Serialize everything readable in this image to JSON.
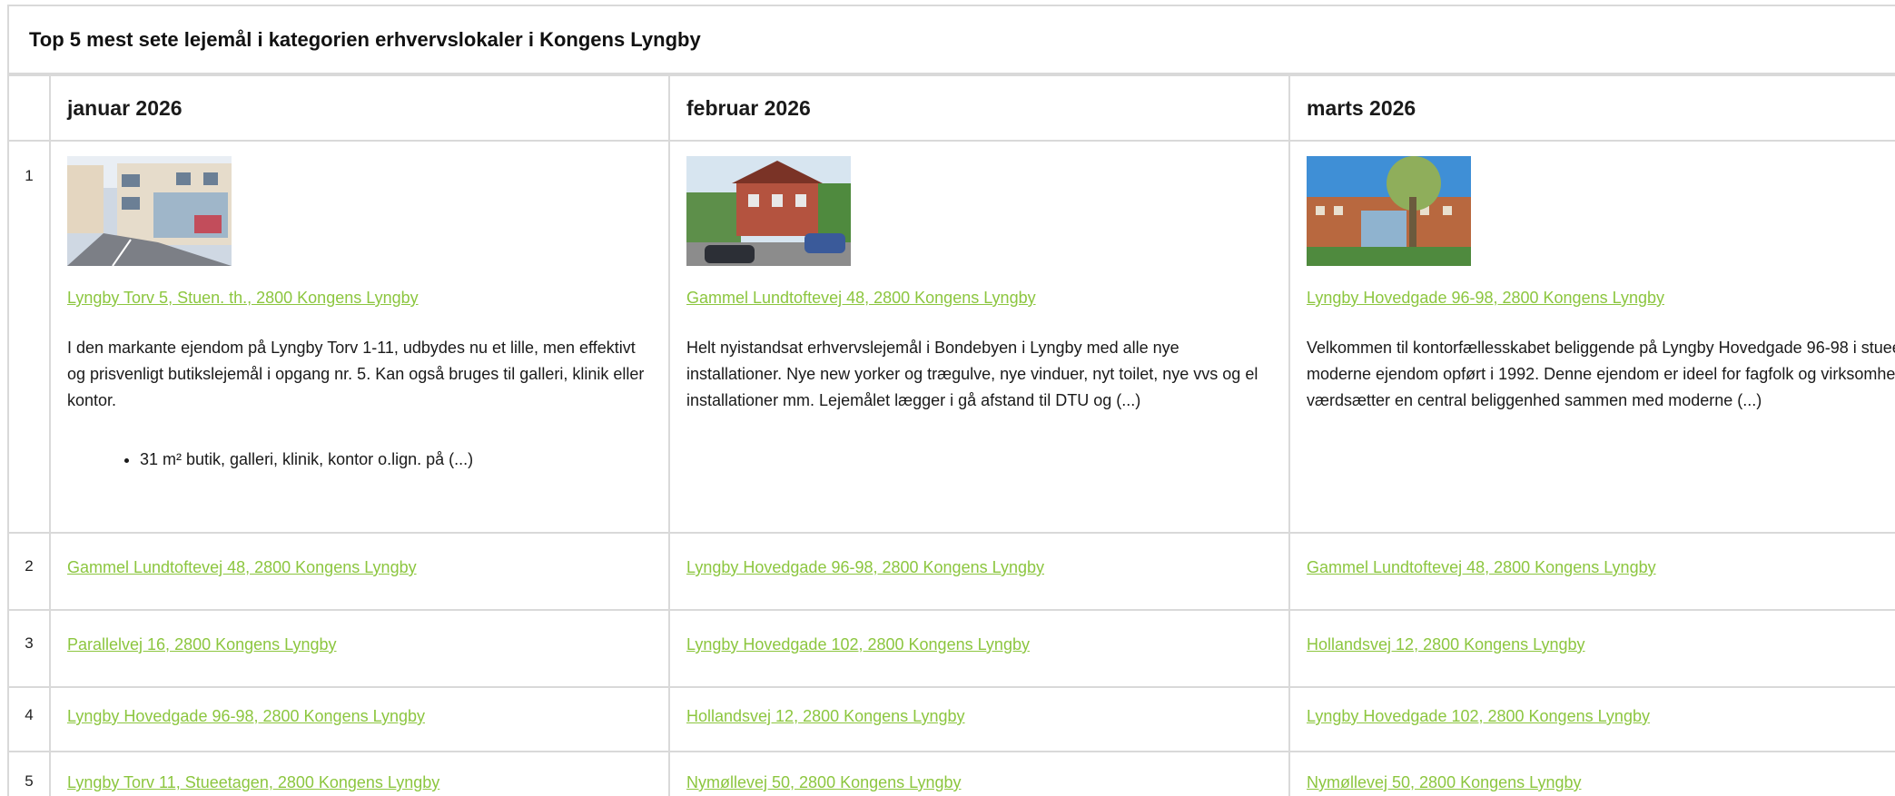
{
  "title": "Top 5 mest sete lejemål i kategorien erhvervslokaler i Kongens Lyngby",
  "colors": {
    "link": "#8cc63f",
    "border": "#d9d9d9"
  },
  "months": [
    "januar 2026",
    "februar 2026",
    "marts 2026"
  ],
  "top": {
    "rank": "1",
    "entries": [
      {
        "image": "street-storefront-photo",
        "address": "Lyngby Torv 5, Stuen. th., 2800 Kongens Lyngby",
        "description": "I den markante ejendom på Lyngby Torv 1-11, udbydes nu et lille, men effektivt og prisvenligt butikslejemål i opgang nr. 5. Kan også bruges til galleri, klinik eller kontor.",
        "bullet": "31 m² butik, galleri, klinik, kontor o.lign. på (...)"
      },
      {
        "image": "red-brick-house-photo",
        "address": "Gammel Lundtoftevej 48, 2800 Kongens Lyngby",
        "description": "Helt nyistandsat erhvervslejemål i Bondebyen i Lyngby med alle nye installationer. Nye new yorker og trægulve, nye vinduer, nyt toilet, nye vvs og el installationer mm. Lejemålet lægger i gå afstand til DTU og (...)"
      },
      {
        "image": "office-building-tree-photo",
        "address": "Lyngby Hovedgade 96-98, 2800 Kongens Lyngby",
        "description": "Velkommen til kontorfællesskabet beliggende på Lyngby Hovedgade 96-98 i stueetagen af en moderne ejendom opført i 1992. Denne ejendom er ideel for fagfolk og virksomheder, der værdsætter en central beliggenhed sammen med moderne (...)"
      }
    ]
  },
  "rows": [
    {
      "rank": "2",
      "links": [
        "Gammel Lundtoftevej 48, 2800 Kongens Lyngby",
        "Lyngby Hovedgade 96-98, 2800 Kongens Lyngby",
        "Gammel Lundtoftevej 48, 2800 Kongens Lyngby"
      ]
    },
    {
      "rank": "3",
      "links": [
        "Parallelvej 16, 2800 Kongens Lyngby",
        "Lyngby Hovedgade 102, 2800 Kongens Lyngby",
        "Hollandsvej 12, 2800 Kongens Lyngby"
      ]
    },
    {
      "rank": "4",
      "links": [
        "Lyngby Hovedgade 96-98, 2800 Kongens Lyngby",
        "Hollandsvej 12, 2800 Kongens Lyngby",
        "Lyngby Hovedgade 102, 2800 Kongens Lyngby"
      ]
    },
    {
      "rank": "5",
      "links": [
        "Lyngby Torv 11, Stueetagen, 2800 Kongens Lyngby",
        "Nymøllevej 50, 2800 Kongens Lyngby",
        "Nymøllevej 50, 2800 Kongens Lyngby"
      ]
    }
  ]
}
